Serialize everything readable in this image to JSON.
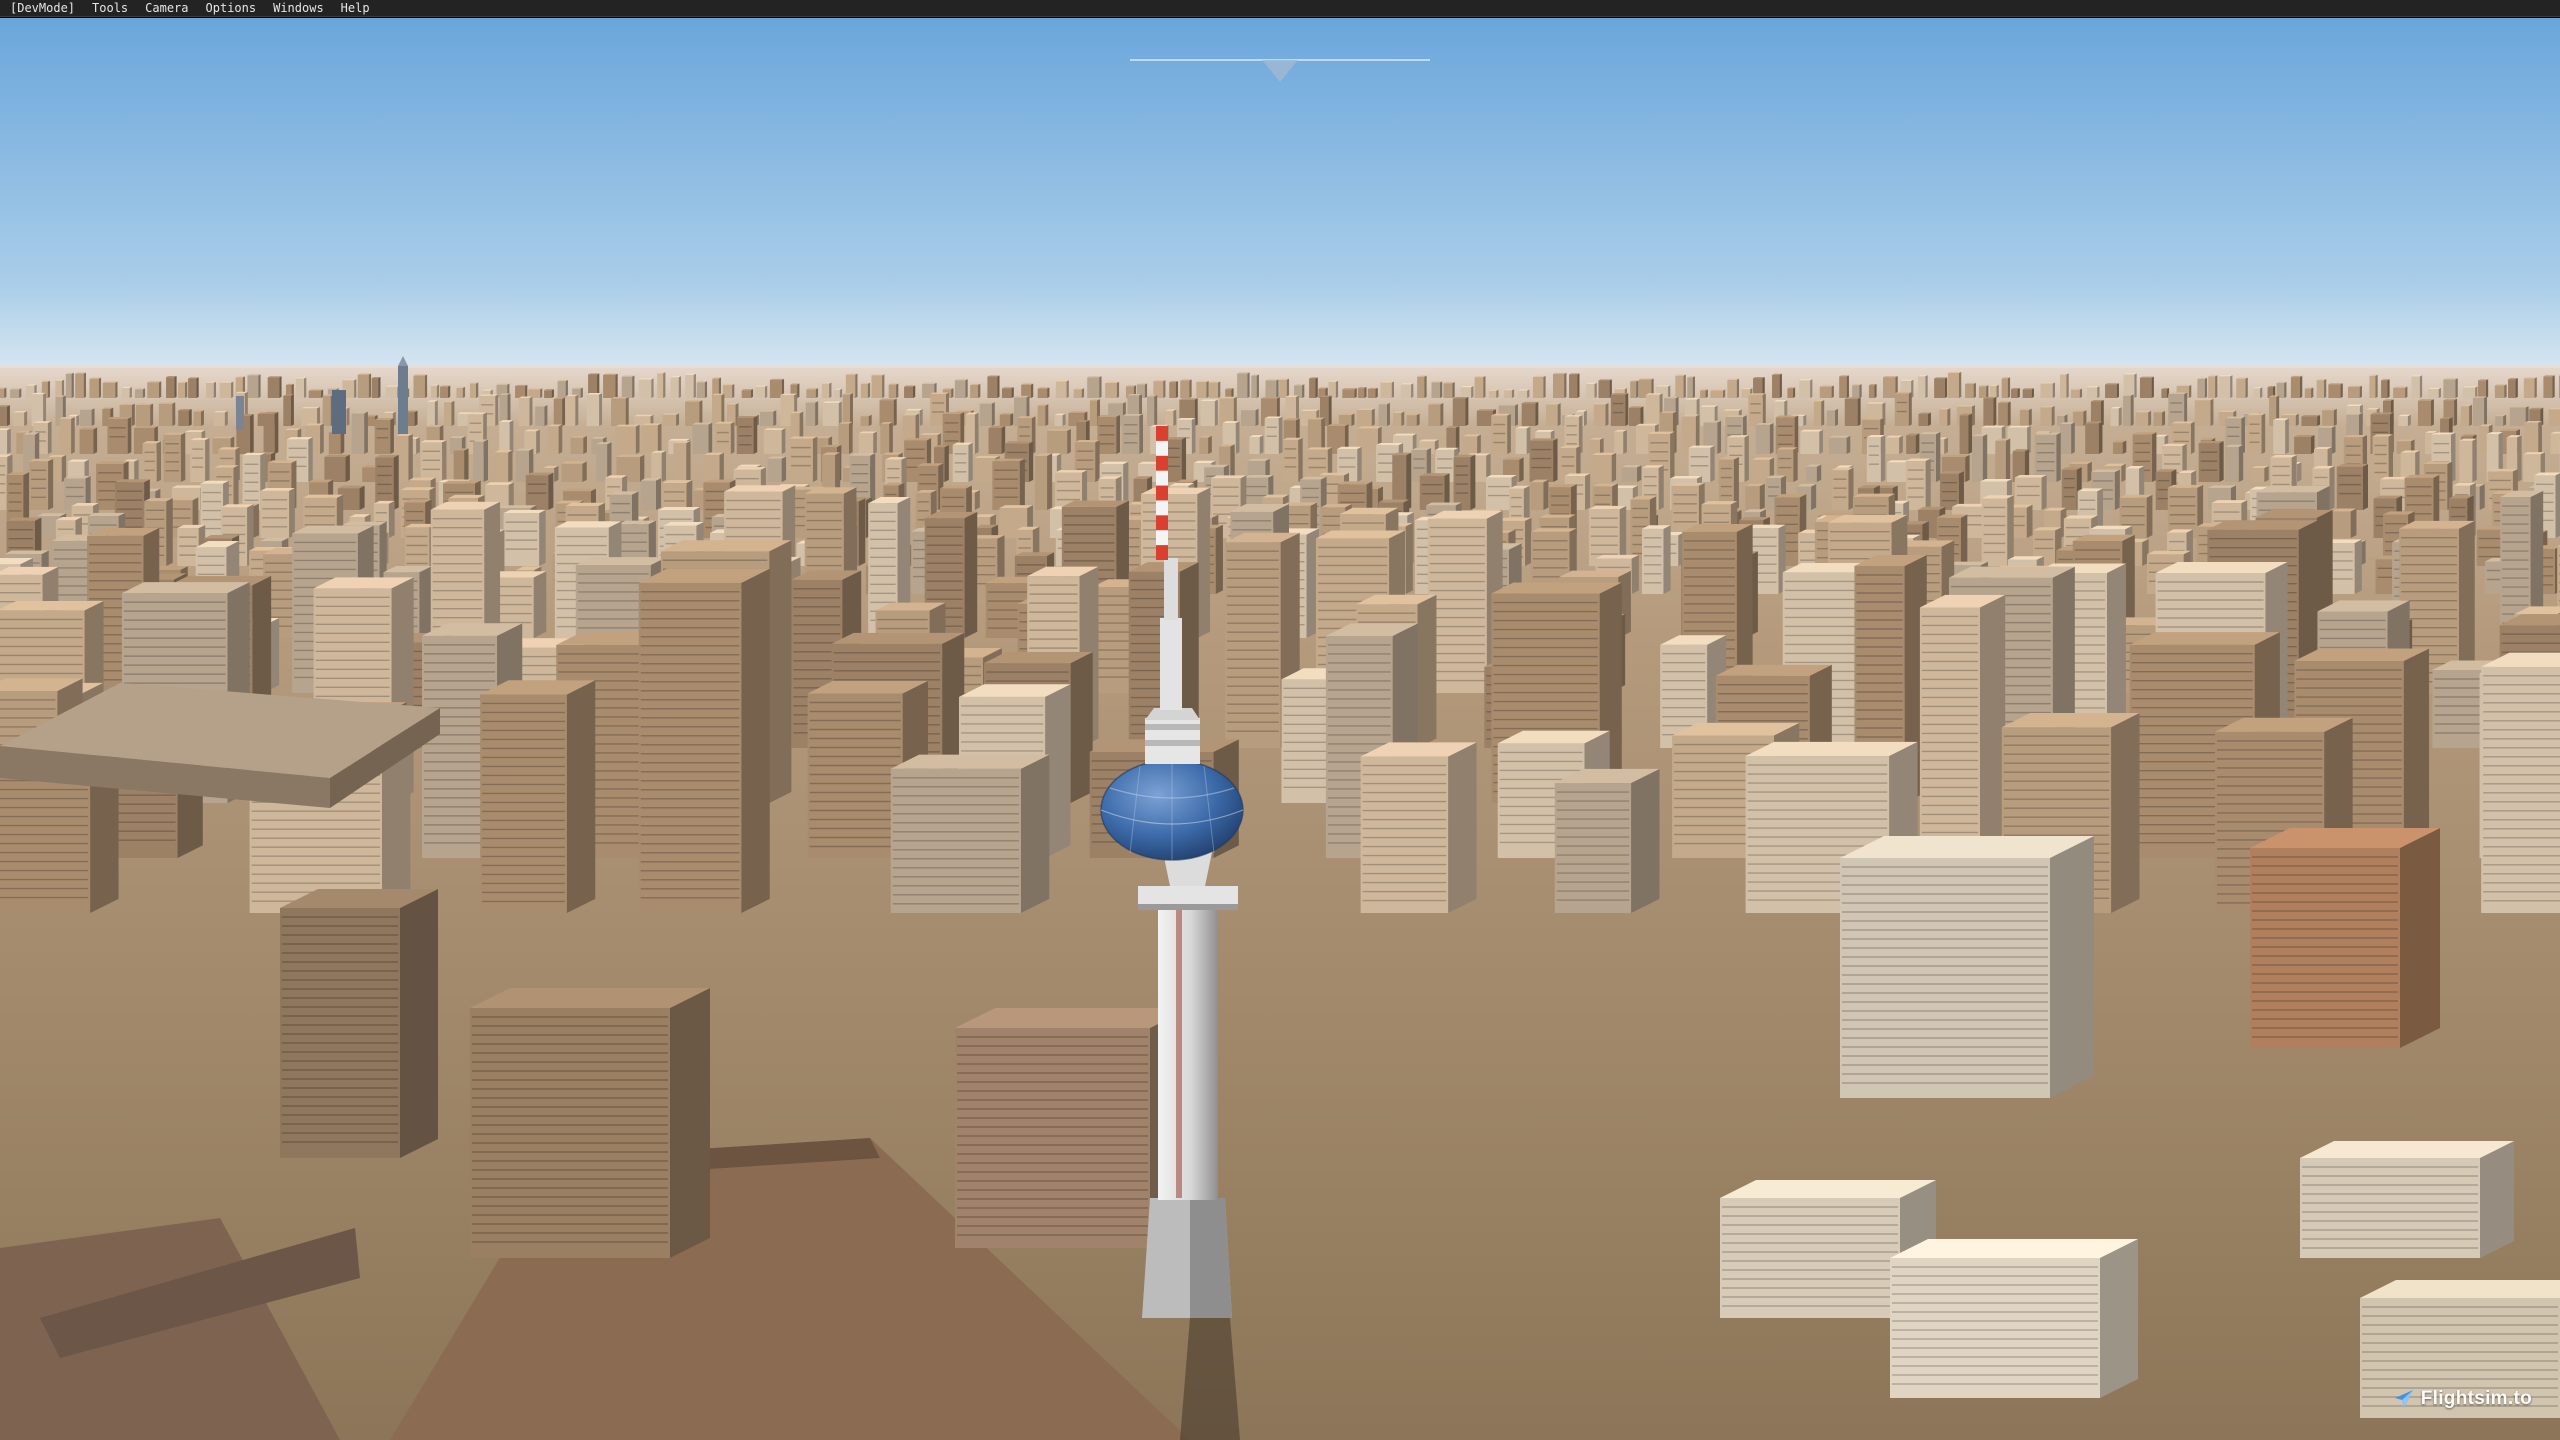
{
  "menubar": {
    "items": [
      {
        "label": "[DevMode]"
      },
      {
        "label": "Tools"
      },
      {
        "label": "Camera"
      },
      {
        "label": "Options"
      },
      {
        "label": "Windows"
      },
      {
        "label": "Help"
      }
    ]
  },
  "scene": {
    "sky_top_color": "#6aa6db",
    "sky_horizon_color": "#d7e6f0",
    "ground_color": "#b79a78",
    "tower_accent_color": "#d9402f",
    "tower_dome_color": "#3b69a8"
  },
  "camera_indicator": {
    "icon": "camera-direction-marker-icon"
  },
  "watermark": {
    "text": "Flightsim.to",
    "icon": "plane-logo-icon"
  }
}
